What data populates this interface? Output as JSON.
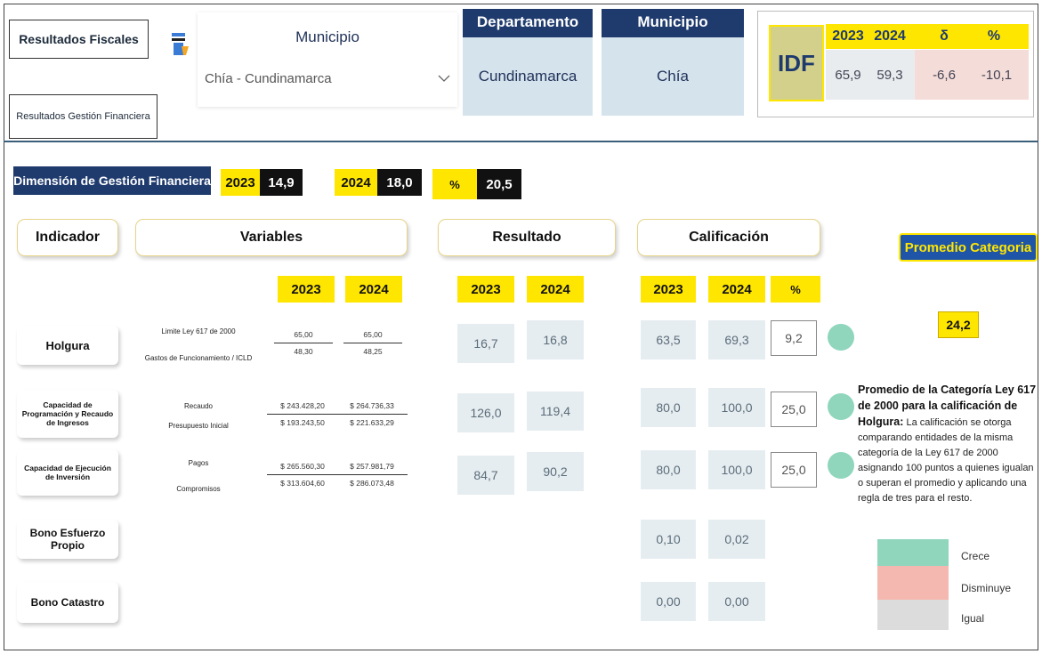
{
  "nav": {
    "fiscal_label": "Resultados Fiscales",
    "gestion_label": "Resultados Gestión Financiera"
  },
  "filter": {
    "title": "Municipio",
    "selected": "Chía - Cundinamarca",
    "icon": "filter-eraser-icon"
  },
  "header": {
    "departamento_title": "Departamento",
    "departamento_value": "Cundinamarca",
    "municipio_title": "Municipio",
    "municipio_value": "Chía"
  },
  "idf": {
    "label": "IDF",
    "cols": [
      "2023",
      "2024",
      "δ",
      "%"
    ],
    "values": [
      "65,9",
      "59,3",
      "-6,6",
      "-10,1"
    ]
  },
  "dimension": {
    "title": "Dimensión de Gestión Financiera",
    "y1_label": "2023",
    "y1_value": "14,9",
    "y2_label": "2024",
    "y2_value": "18,0",
    "pct_label": "%",
    "pct_value": "20,5"
  },
  "columns": {
    "indicador": "Indicador",
    "variables": "Variables",
    "resultado": "Resultado",
    "calificacion": "Calificación",
    "promedio": "Promedio Categoria"
  },
  "years": {
    "var_2023": "2023",
    "var_2024": "2024",
    "res_2023": "2023",
    "res_2024": "2024",
    "cal_2023": "2023",
    "cal_2024": "2024",
    "cal_pct": "%"
  },
  "rows": [
    {
      "indicador": "Holgura",
      "var_num_label": "Limite Ley 617 de 2000",
      "var_den_label": "Gastos de Funcionamiento / ICLD",
      "v2023_num": "65,00",
      "v2023_den": "48,30",
      "v2024_num": "65,00",
      "v2024_den": "48,25",
      "res_2023": "16,7",
      "res_2024": "16,8",
      "cal_2023": "63,5",
      "cal_2024": "69,3",
      "pct": "9,2",
      "trend": "Crece"
    },
    {
      "indicador": "Capacidad de Programación y Recaudo de Ingresos",
      "var_num_label": "Recaudo",
      "var_den_label": "Presupuesto Inicial",
      "v2023_num": "$ 243.428,20",
      "v2023_den": "$ 193.243,50",
      "v2024_num": "$ 264.736,33",
      "v2024_den": "$ 221.633,29",
      "res_2023": "126,0",
      "res_2024": "119,4",
      "cal_2023": "80,0",
      "cal_2024": "100,0",
      "pct": "25,0",
      "trend": "Crece"
    },
    {
      "indicador": "Capacidad de Ejecución de Inversión",
      "var_num_label": "Pagos",
      "var_den_label": "Compromisos",
      "v2023_num": "$ 265.560,30",
      "v2023_den": "$ 313.604,60",
      "v2024_num": "$ 257.981,79",
      "v2024_den": "$ 286.073,48",
      "res_2023": "84,7",
      "res_2024": "90,2",
      "cal_2023": "80,0",
      "cal_2024": "100,0",
      "pct": "25,0",
      "trend": "Crece"
    },
    {
      "indicador": "Bono Esfuerzo Propio",
      "cal_2023": "0,10",
      "cal_2024": "0,02"
    },
    {
      "indicador": "Bono Catastro",
      "cal_2023": "0,00",
      "cal_2024": "0,00"
    }
  ],
  "promedio": {
    "value": "24,2",
    "note_bold": "Promedio de la Categoría Ley 617 de 2000 para la calificación de Holgura:",
    "note_text": "La calificación se otorga comparando entidades de la misma categoría de la Ley 617 de 2000 asignando 100 puntos a quienes igualan o superan el promedio y aplicando una regla de tres para el resto."
  },
  "legend": {
    "crece": "Crece",
    "disminuye": "Disminuye",
    "igual": "Igual",
    "colors": {
      "crece": "#8fd6bd",
      "disminuye": "#f4b8b0",
      "igual": "#dcdcdc"
    }
  }
}
